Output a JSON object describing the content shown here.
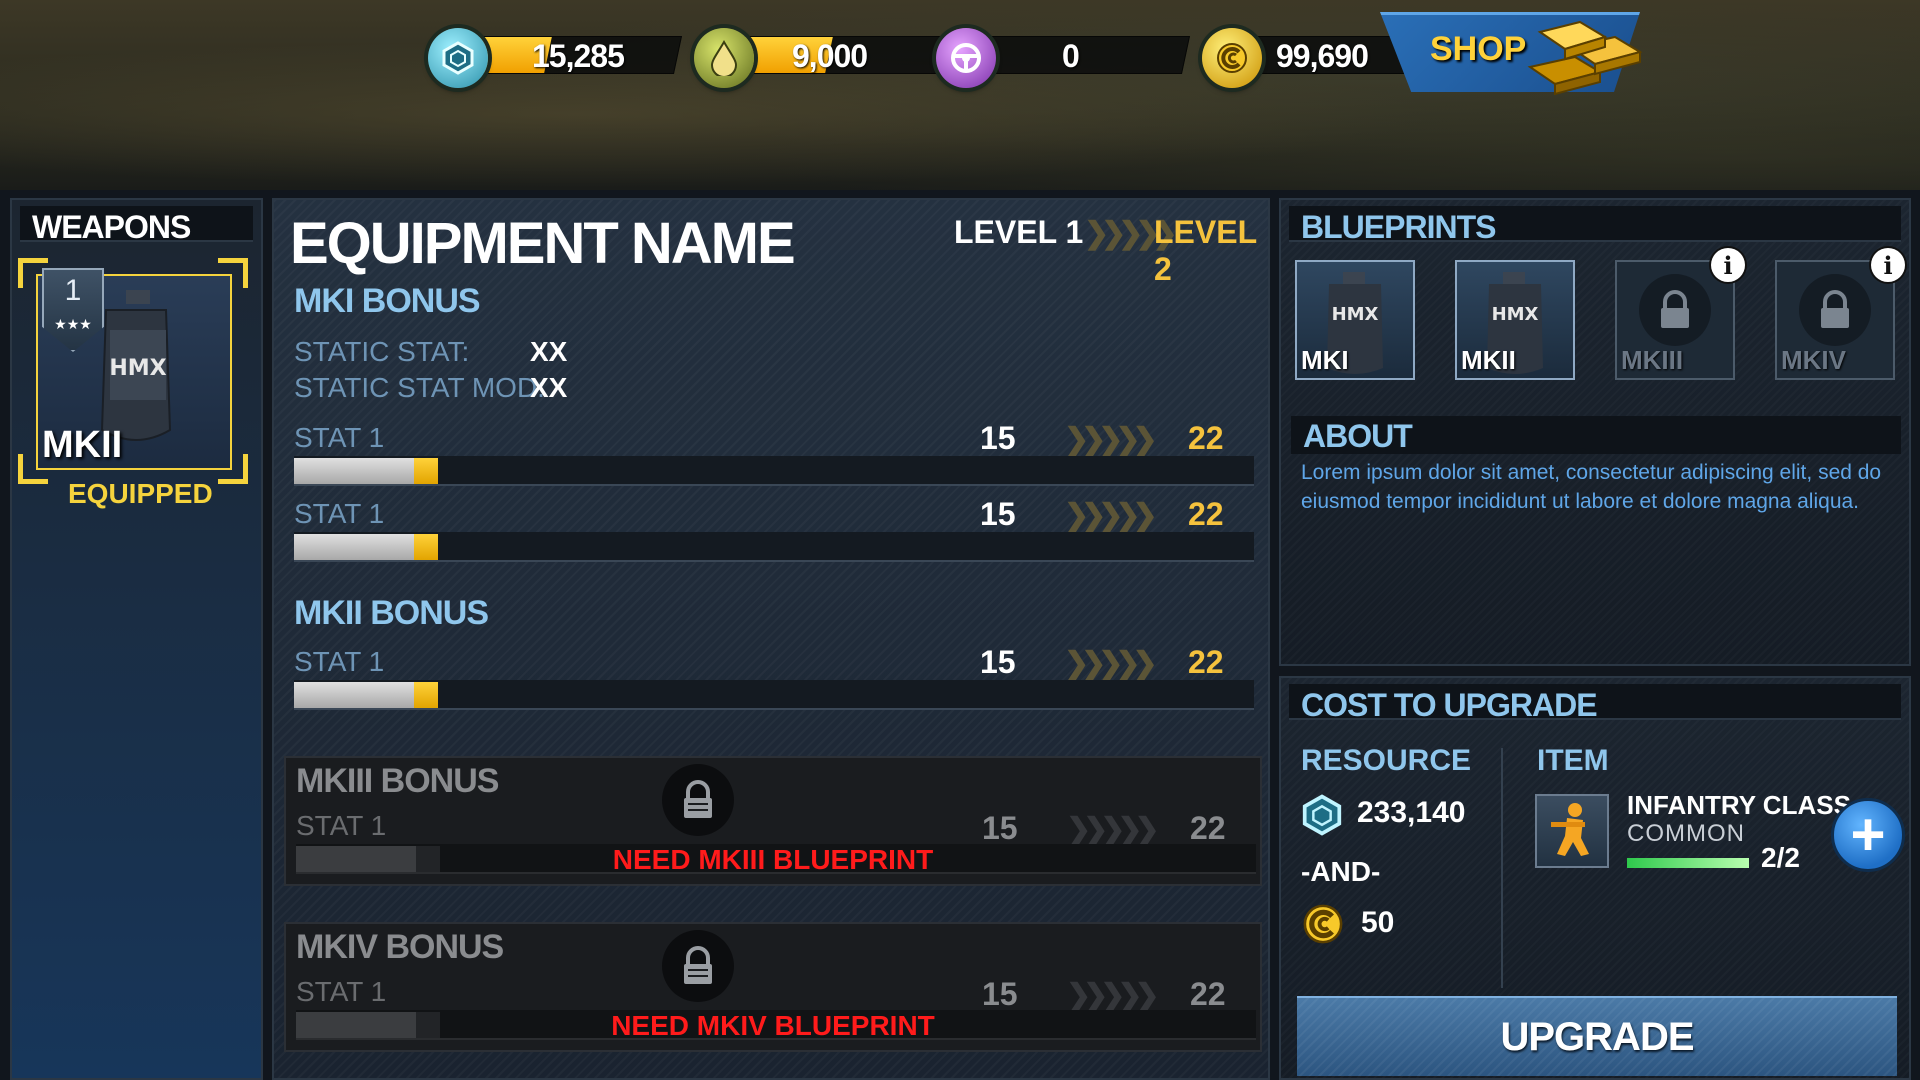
{
  "topbar": {
    "resources": [
      {
        "name": "hex-resource-icon",
        "value": "15,285",
        "fill": 0.38,
        "color": "#7ad3e8"
      },
      {
        "name": "oil-drop-icon",
        "value": "9,000",
        "fill": 0.45,
        "color": "#c9c23a"
      },
      {
        "name": "steering-wheel-icon",
        "value": "0",
        "fill": 0,
        "color": "#b05ad8"
      },
      {
        "name": "coin-icon",
        "value": "99,690",
        "fill": 0,
        "color": "#f5c23d"
      }
    ],
    "shop_label": "SHOP"
  },
  "weapons": {
    "title": "WEAPONS",
    "rank": "1",
    "item_label": "MKII",
    "equipped_label": "EQUIPPED"
  },
  "equipment": {
    "title": "EQUIPMENT NAME",
    "level_from": "LEVEL 1",
    "level_to": "LEVEL 2",
    "mk1": {
      "title": "MKI BONUS",
      "static_stat_label": "STATIC STAT:",
      "static_stat_value": "XX",
      "static_stat_mod_label": "STATIC STAT MOD:",
      "static_stat_mod_value": "XX",
      "stats": [
        {
          "label": "STAT 1",
          "from": "15",
          "to": "22",
          "base_pct": 0.125,
          "add_pct": 0.025
        },
        {
          "label": "STAT 1",
          "from": "15",
          "to": "22",
          "base_pct": 0.125,
          "add_pct": 0.025
        }
      ]
    },
    "mk2": {
      "title": "MKII BONUS",
      "stats": [
        {
          "label": "STAT 1",
          "from": "15",
          "to": "22",
          "base_pct": 0.125,
          "add_pct": 0.025
        }
      ]
    },
    "mk3": {
      "title": "MKIII BONUS",
      "stat_label": "STAT 1",
      "from": "15",
      "to": "22",
      "need": "NEED MKIII BLUEPRINT"
    },
    "mk4": {
      "title": "MKIV BONUS",
      "stat_label": "STAT 1",
      "from": "15",
      "to": "22",
      "need": "NEED MKIV BLUEPRINT"
    }
  },
  "blueprints": {
    "title": "BLUEPRINTS",
    "cards": [
      {
        "label": "MKI",
        "locked": false
      },
      {
        "label": "MKII",
        "locked": false
      },
      {
        "label": "MKIII",
        "locked": true
      },
      {
        "label": "MKIV",
        "locked": true
      }
    ],
    "info_glyph": "i",
    "about_title": "ABOUT",
    "about_text": "Lorem ipsum dolor sit amet, consectetur adipiscing elit, sed do eiusmod tempor incididunt ut labore et dolore magna aliqua."
  },
  "cost": {
    "title": "COST TO UPGRADE",
    "resource_header": "RESOURCE",
    "item_header": "ITEM",
    "resource_amount": "233,140",
    "and_label": "-AND-",
    "coin_amount": "50",
    "item_name": "INFANTRY CLASS",
    "item_rarity": "COMMON",
    "item_count": "2/2",
    "item_progress": 1.0,
    "plus_glyph": "+",
    "upgrade_label": "UPGRADE"
  }
}
